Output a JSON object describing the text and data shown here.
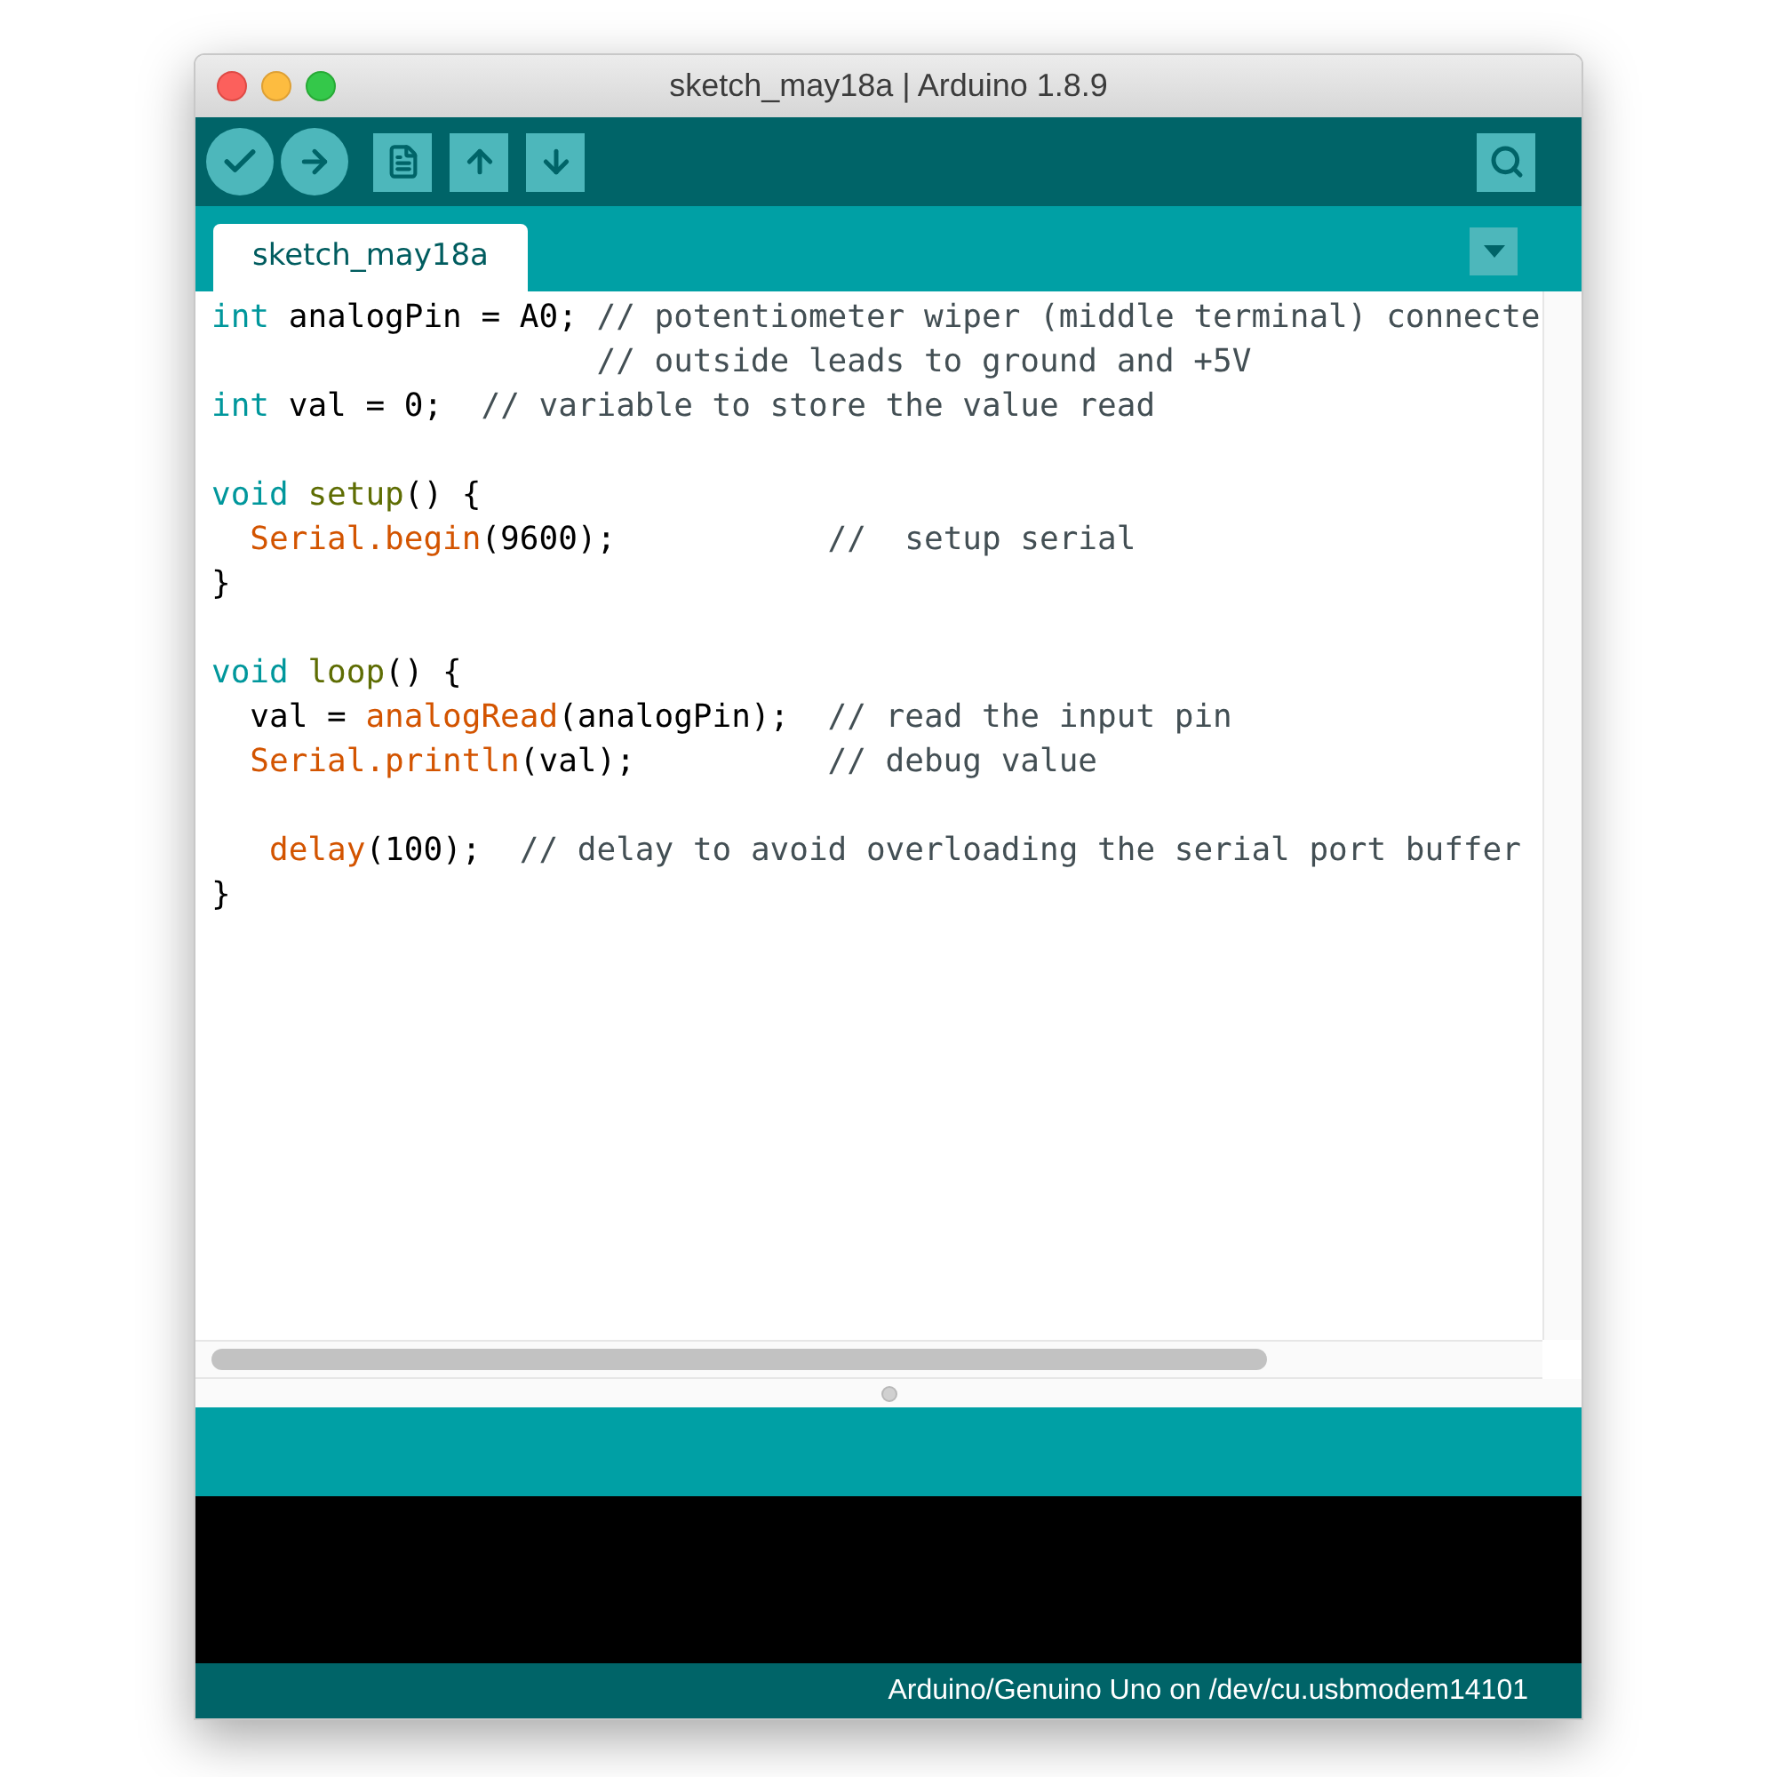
{
  "window": {
    "title": "sketch_may18a | Arduino 1.8.9"
  },
  "toolbar": {
    "buttons": [
      {
        "kind": "verify"
      },
      {
        "kind": "upload"
      },
      {
        "kind": "new"
      },
      {
        "kind": "open"
      },
      {
        "kind": "save"
      }
    ],
    "right_button": {
      "kind": "monitor"
    }
  },
  "tabs": [
    {
      "label": "sketch_may18a",
      "selected": true
    }
  ],
  "editor": {
    "lines": [
      {
        "kind": "code",
        "tokens": [
          {
            "kind": "type",
            "text": "int"
          },
          {
            "kind": "plain",
            "text": " analogPin = A0; "
          },
          {
            "kind": "comment",
            "text": "// potentiometer wiper (middle terminal) connecte"
          }
        ]
      },
      {
        "kind": "code",
        "tokens": [
          {
            "kind": "comment",
            "text": "                    // outside leads to ground and +5V"
          }
        ]
      },
      {
        "kind": "code",
        "tokens": [
          {
            "kind": "type",
            "text": "int"
          },
          {
            "kind": "plain",
            "text": " val = 0;  "
          },
          {
            "kind": "comment",
            "text": "// variable to store the value read"
          }
        ]
      },
      {
        "kind": "blank"
      },
      {
        "kind": "code",
        "tokens": [
          {
            "kind": "type",
            "text": "void "
          },
          {
            "kind": "func",
            "text": "setup"
          },
          {
            "kind": "plain",
            "text": "() {"
          }
        ]
      },
      {
        "kind": "code",
        "tokens": [
          {
            "kind": "builtin",
            "text": "  Serial.begin"
          },
          {
            "kind": "plain",
            "text": "(9600);           "
          },
          {
            "kind": "comment",
            "text": "//  setup serial"
          }
        ]
      },
      {
        "kind": "code",
        "tokens": [
          {
            "kind": "plain",
            "text": "}"
          }
        ]
      },
      {
        "kind": "blank"
      },
      {
        "kind": "code",
        "tokens": [
          {
            "kind": "type",
            "text": "void "
          },
          {
            "kind": "func",
            "text": "loop"
          },
          {
            "kind": "plain",
            "text": "() {"
          }
        ]
      },
      {
        "kind": "code",
        "tokens": [
          {
            "kind": "plain",
            "text": "  val = "
          },
          {
            "kind": "builtin",
            "text": "analogRead"
          },
          {
            "kind": "plain",
            "text": "(analogPin);  "
          },
          {
            "kind": "comment",
            "text": "// read the input pin"
          }
        ]
      },
      {
        "kind": "code",
        "tokens": [
          {
            "kind": "builtin",
            "text": "  Serial.println"
          },
          {
            "kind": "plain",
            "text": "(val);          "
          },
          {
            "kind": "comment",
            "text": "// debug value"
          }
        ]
      },
      {
        "kind": "blank"
      },
      {
        "kind": "code",
        "tokens": [
          {
            "kind": "builtin",
            "text": "   delay"
          },
          {
            "kind": "plain",
            "text": "(100);  "
          },
          {
            "kind": "comment",
            "text": "// delay to avoid overloading the serial port buffer"
          }
        ]
      },
      {
        "kind": "code",
        "tokens": [
          {
            "kind": "plain",
            "text": "}"
          }
        ]
      }
    ]
  },
  "status_bar": {
    "text": "Arduino/Genuino Uno on /dev/cu.usbmodem14101"
  }
}
